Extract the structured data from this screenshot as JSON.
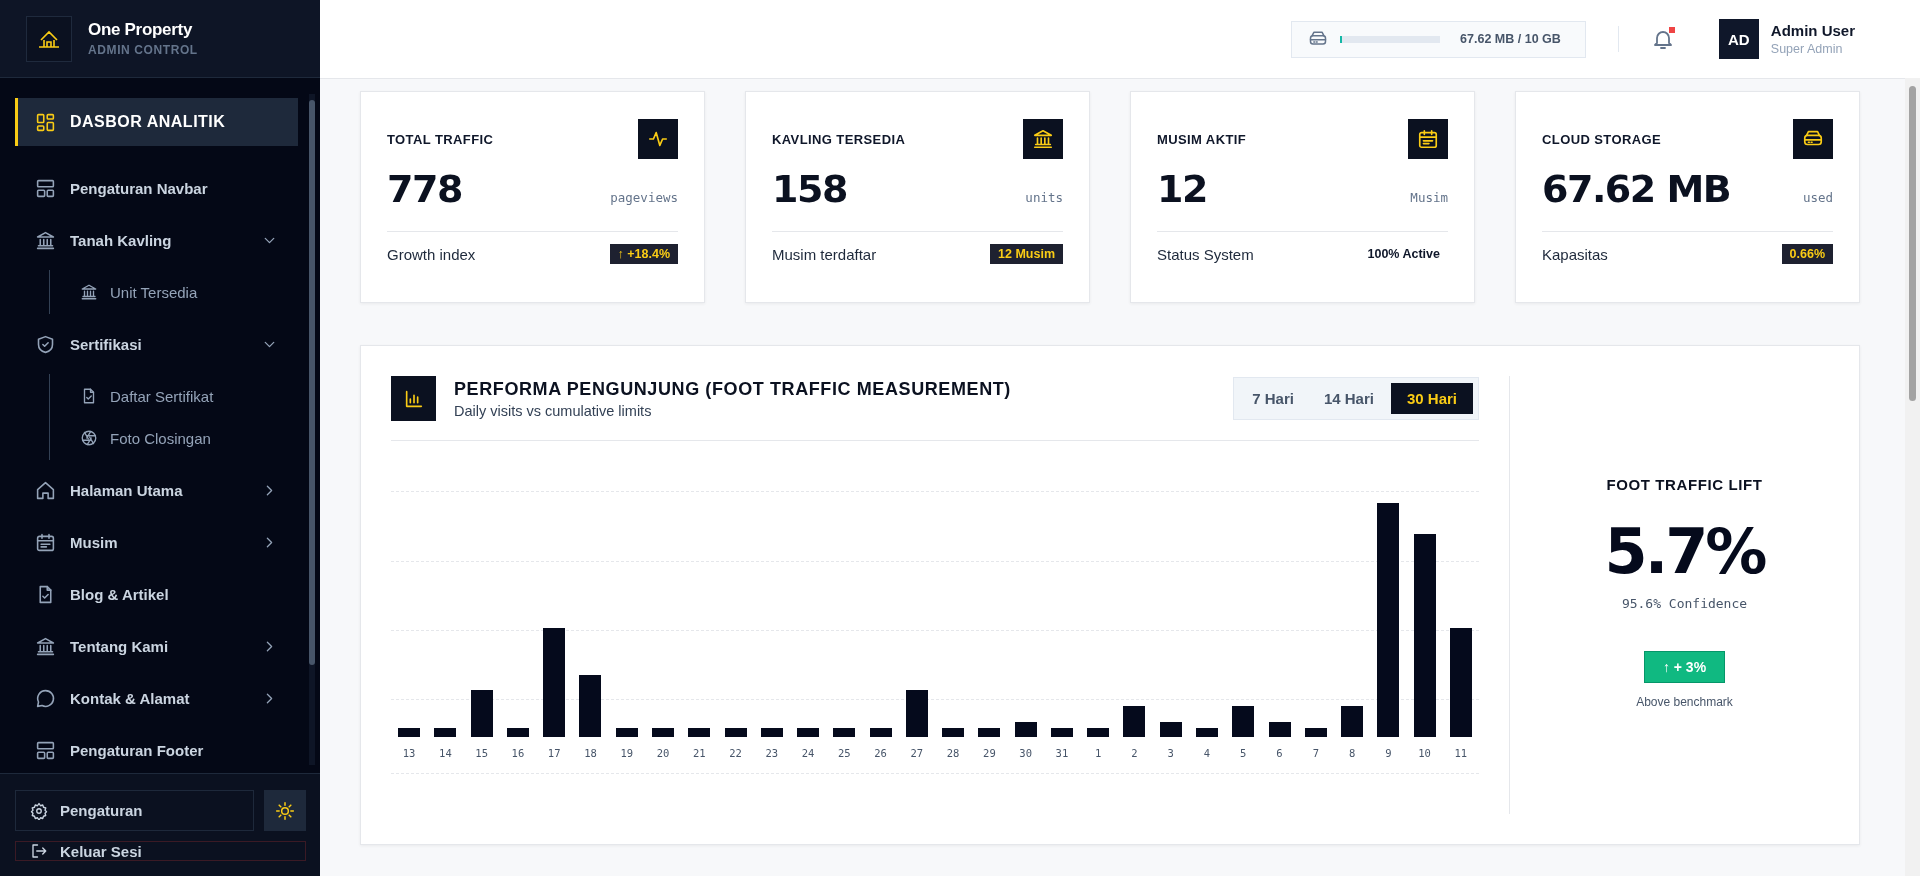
{
  "sidebar": {
    "brand": {
      "name": "One Property",
      "subtitle": "ADMIN CONTROL"
    },
    "items": [
      {
        "label": "DASBOR ANALITIK",
        "kind": "link",
        "selected": true
      },
      {
        "label": "Pengaturan Navbar",
        "kind": "link",
        "selected": false
      },
      {
        "label": "Tanah Kavling",
        "kind": "group",
        "selected": false,
        "expanded": true,
        "children": [
          {
            "label": "Unit Tersedia",
            "selected": false
          }
        ]
      },
      {
        "label": "Sertifikasi",
        "kind": "group",
        "selected": false,
        "expanded": true,
        "children": [
          {
            "label": "Daftar Sertifikat",
            "selected": false
          },
          {
            "label": "Foto Closingan",
            "selected": false
          }
        ]
      },
      {
        "label": "Halaman Utama",
        "kind": "group",
        "selected": false,
        "expanded": false
      },
      {
        "label": "Musim",
        "kind": "group",
        "selected": false,
        "expanded": false
      },
      {
        "label": "Blog & Artikel",
        "kind": "link",
        "selected": false
      },
      {
        "label": "Tentang Kami",
        "kind": "group",
        "selected": false,
        "expanded": false
      },
      {
        "label": "Kontak & Alamat",
        "kind": "group",
        "selected": false,
        "expanded": false
      },
      {
        "label": "Pengaturan Footer",
        "kind": "link",
        "selected": false
      }
    ],
    "settings_button": "Pengaturan",
    "logout_button": "Keluar Sesi"
  },
  "header": {
    "storage": {
      "reading": "67.62 MB / 10 GB",
      "level": 0.0066
    },
    "notifications": {
      "unread": true
    },
    "user": {
      "initials": "AD",
      "name": "Admin User",
      "role": "Super Admin"
    }
  },
  "cards": [
    {
      "title": "TOTAL TRAFFIC",
      "value": "778",
      "unit": "pageviews",
      "footer_label": "Growth index",
      "footer_value": "↑ +18.4%",
      "badge": true
    },
    {
      "title": "KAVLING TERSEDIA",
      "value": "158",
      "unit": "units",
      "footer_label": "Musim terdaftar",
      "footer_value": "12 Musim",
      "badge": true
    },
    {
      "title": "MUSIM AKTIF",
      "value": "12",
      "unit": "Musim",
      "footer_label": "Status System",
      "footer_value": "100% Active",
      "badge": false
    },
    {
      "title": "CLOUD STORAGE",
      "value": "67.62 MB",
      "unit": "used",
      "footer_label": "Kapasitas",
      "footer_value": "0.66%",
      "badge": true
    }
  ],
  "traffic": {
    "title": "PERFORMA PENGUNJUNG (FOOT TRAFFIC MEASUREMENT)",
    "subtitle": "Daily visits vs cumulative limits",
    "ranges": [
      {
        "label": "7 Hari",
        "selected": false
      },
      {
        "label": "14 Hari",
        "selected": false
      },
      {
        "label": "30 Hari",
        "selected": true
      }
    ],
    "day_labels": [
      "13",
      "14",
      "15",
      "16",
      "17",
      "18",
      "19",
      "20",
      "21",
      "22",
      "23",
      "24",
      "25",
      "26",
      "27",
      "28",
      "29",
      "30",
      "31",
      "1",
      "2",
      "3",
      "4",
      "5",
      "6",
      "7",
      "8",
      "9",
      "10",
      "11"
    ],
    "lift": {
      "title": "FOOT TRAFFIC LIFT",
      "value": "5.7%",
      "confidence": "95.6% Confidence",
      "change": "↑ + 3%",
      "note": "Above benchmark"
    }
  }
}
